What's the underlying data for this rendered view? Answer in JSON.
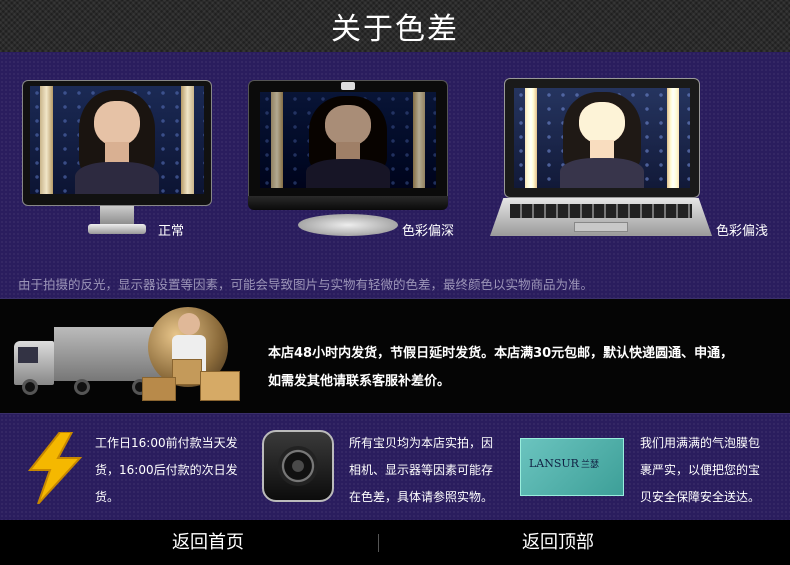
{
  "header": {
    "title": "关于色差"
  },
  "monitors": [
    {
      "label": "正常"
    },
    {
      "label": "色彩偏深"
    },
    {
      "label": "色彩偏浅"
    }
  ],
  "disclaimer": "由于拍摄的反光，显示器设置等因素，可能会导致图片与实物有轻微的色差，最终颜色以实物商品为准。",
  "shipping": {
    "line1": "本店48小时内发货，节假日延时发货。本店满30元包邮，默认快递圆通、申通，",
    "line2": "如需发其他请联系客服补差价。"
  },
  "info": [
    {
      "icon": "lightning-icon",
      "lines": [
        "工作日16:00前付款当天发",
        "货，16:00后付款的次日发",
        "货。"
      ]
    },
    {
      "icon": "camera-icon",
      "lines": [
        "所有宝贝均为本店实拍，因",
        "相机、显示器等因素可能存",
        "在色差，具体请参照实物。"
      ]
    },
    {
      "icon": "package-icon",
      "brand": "LANSUR",
      "brand_cn": "兰瑟",
      "lines": [
        "我们用满满的气泡膜包",
        "裹严实，以便把您的宝",
        "贝安全保障安全送达。"
      ]
    }
  ],
  "footer": {
    "home": "返回首页",
    "top": "返回顶部"
  },
  "colors": {
    "band": "#2a1d5e",
    "lightning": "#f5b800"
  }
}
